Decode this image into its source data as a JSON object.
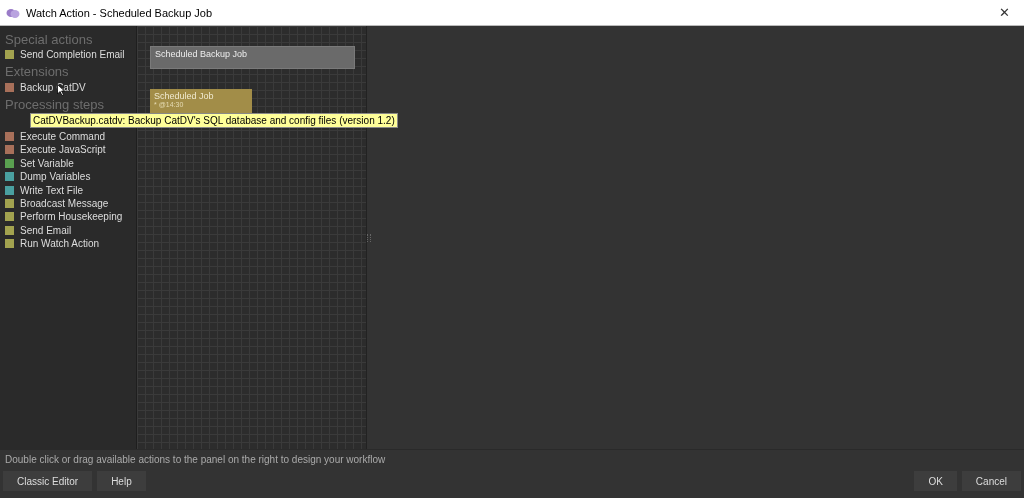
{
  "window": {
    "title": "Watch Action - Scheduled Backup Job",
    "close": "✕"
  },
  "sidebar": {
    "groups": [
      {
        "heading": "Special actions",
        "items": [
          {
            "label": "Send Completion Email",
            "color": "#a3a34f"
          }
        ]
      },
      {
        "heading": "Extensions",
        "items": [
          {
            "label": "Backup CatDV",
            "color": "#a8705a"
          }
        ]
      },
      {
        "heading": "Processing steps",
        "items": [
          {
            "label": "Execute Command",
            "color": "#a8705a"
          },
          {
            "label": "Execute JavaScript",
            "color": "#a8705a"
          },
          {
            "label": "Set Variable",
            "color": "#5aa050"
          },
          {
            "label": "Dump Variables",
            "color": "#4aa0a0"
          },
          {
            "label": "Write Text File",
            "color": "#4aa0a0"
          },
          {
            "label": "Broadcast Message",
            "color": "#a3a34f"
          },
          {
            "label": "Perform Housekeeping",
            "color": "#a3a34f"
          },
          {
            "label": "Send Email",
            "color": "#a3a34f"
          },
          {
            "label": "Run Watch Action",
            "color": "#a3a34f"
          }
        ]
      }
    ]
  },
  "tooltip": "CatDVBackup.catdv: Backup CatDV's SQL database and config files (version 1.2)",
  "canvas": {
    "nodes": [
      {
        "kind": "job",
        "title": "Scheduled Backup Job"
      },
      {
        "kind": "trigger",
        "title": "Scheduled Job",
        "detail": "* @14:30"
      }
    ]
  },
  "hint": "Double click or drag available actions to the panel on the right to design your workflow",
  "buttons_left": [
    "Classic Editor",
    "Help"
  ],
  "buttons_right": [
    "OK",
    "Cancel"
  ]
}
